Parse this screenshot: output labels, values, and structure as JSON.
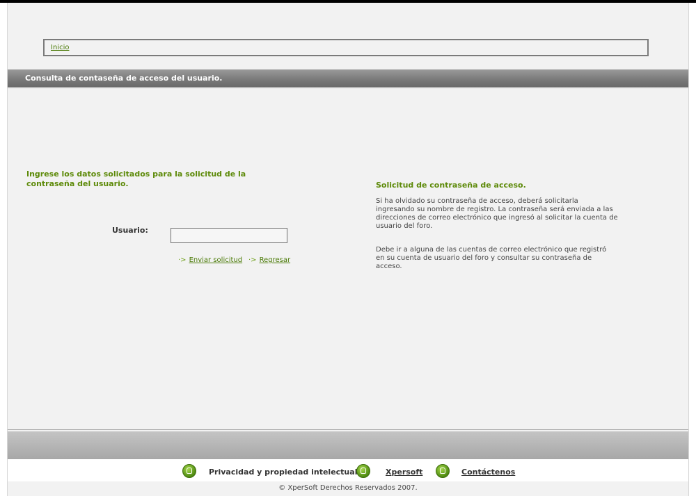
{
  "breadcrumb": {
    "home": "Inicio"
  },
  "page_title": "Consulta de contaseña de acceso del usuario.",
  "form": {
    "heading_line1": "Ingrese los datos solicitados para la solicitud de la",
    "heading_line2": "contraseña del usuario.",
    "user_label": "Usuario:",
    "user_value": "",
    "submit": "Enviar solicitud",
    "back": "Regresar"
  },
  "info": {
    "heading": "Solicitud de contraseña de acceso.",
    "p1_lines": [
      "Si ha olvidado su contraseña de acceso, deberá solicitarla",
      "ingresando su nombre de registro. La contraseña será enviada a las",
      "direcciones de correo electrónico que ingresó al solicitar la cuenta de",
      "usuario del foro."
    ],
    "p2_lines": [
      "Debe ir a alguna de las cuentas de correo electrónico que registró",
      "en su cuenta de usuario del foro y consultar su contraseña de",
      "acceso."
    ]
  },
  "footer": {
    "privacy": "Privacidad y propiedad intelectual",
    "xpersoft": "Xpersoft",
    "contact": "Contáctenos",
    "copyright": "© XperSoft Derechos Reservados 2007."
  },
  "colors": {
    "accent_green": "#5d8a09",
    "title_bar": "#7b7b7b",
    "background": "#f2f2f2"
  }
}
